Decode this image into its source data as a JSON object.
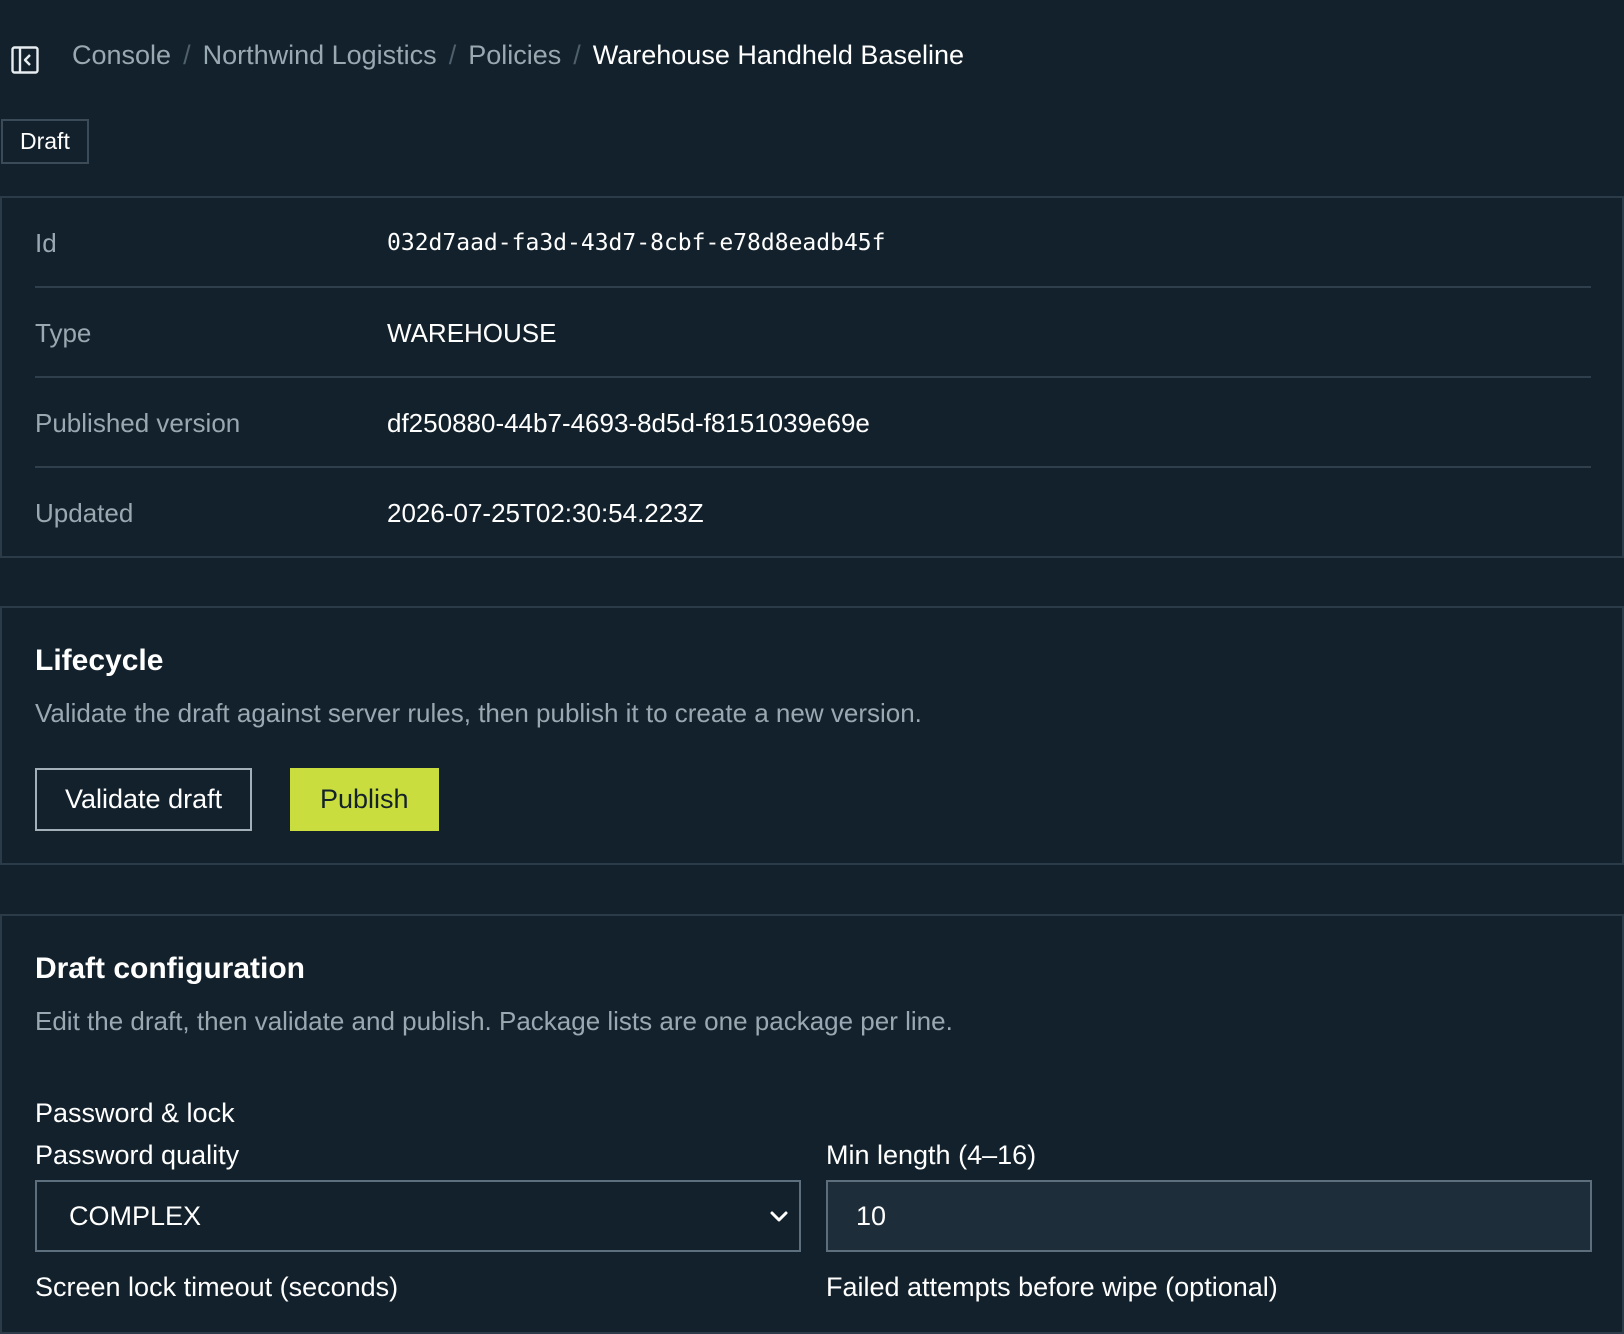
{
  "breadcrumb": {
    "items": [
      "Console",
      "Northwind Logistics",
      "Policies"
    ],
    "current": "Warehouse Handheld Baseline",
    "separator": "/"
  },
  "status_badge": "Draft",
  "details": [
    {
      "label": "Id",
      "value": "032d7aad-fa3d-43d7-8cbf-e78d8eadb45f"
    },
    {
      "label": "Type",
      "value": "WAREHOUSE"
    },
    {
      "label": "Published version",
      "value": "df250880-44b7-4693-8d5d-f8151039e69e"
    },
    {
      "label": "Updated",
      "value": "2026-07-25T02:30:54.223Z"
    }
  ],
  "lifecycle": {
    "title": "Lifecycle",
    "description": "Validate the draft against server rules, then publish it to create a new version.",
    "validate_label": "Validate draft",
    "publish_label": "Publish"
  },
  "config": {
    "title": "Draft configuration",
    "description": "Edit the draft, then validate and publish. Package lists are one package per line.",
    "section": "Password & lock",
    "password_quality": {
      "label": "Password quality",
      "value": "COMPLEX"
    },
    "min_length": {
      "label": "Min length (4–16)",
      "value": "10"
    },
    "screen_lock_label": "Screen lock timeout (seconds)",
    "failed_attempts_label": "Failed attempts before wipe (optional)"
  },
  "colors": {
    "background": "#12212b",
    "accent": "#c9de3e",
    "muted_text": "#9aa8b2",
    "border": "#2b3b47"
  },
  "icons": {
    "sidebar_toggle": "sidebar-collapse-icon",
    "select_chevron": "chevron-down-icon"
  }
}
